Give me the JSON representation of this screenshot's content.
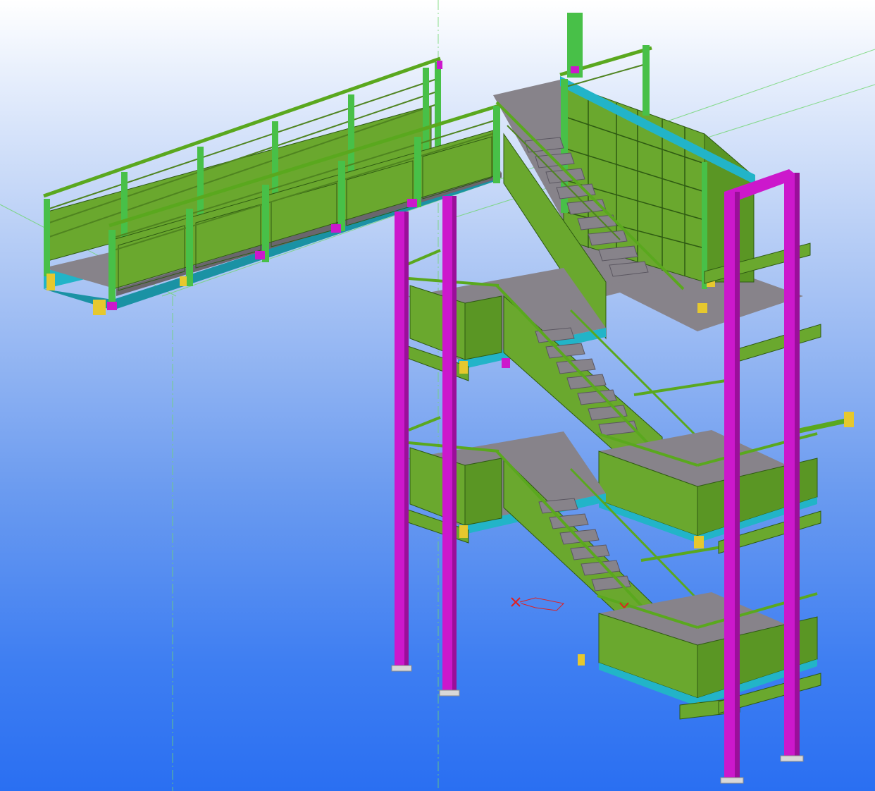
{
  "view": {
    "background_top": "#ffffff",
    "background_bottom": "#2a6ff2",
    "grid_color": "#6fd66f"
  },
  "model": {
    "colors": {
      "column": "#cc18cc",
      "column_dark": "#9a0f9a",
      "guardrail": "#5aa81e",
      "panel": "#6aa82e",
      "panel_dark": "#4f8420",
      "edge_beam": "#22b4c8",
      "deck": "#87838a",
      "deck_dark": "#6a666d",
      "post": "#48c048",
      "plate": "#e6c82e",
      "marker": "#e02020"
    }
  }
}
